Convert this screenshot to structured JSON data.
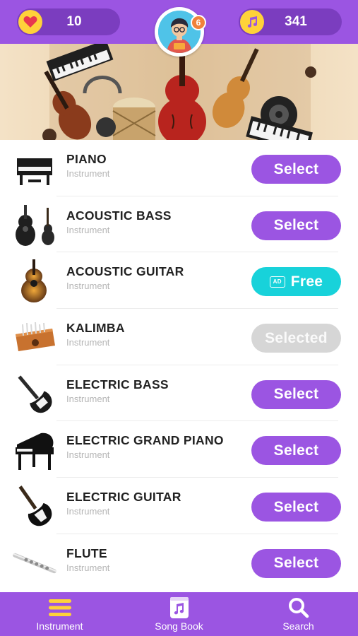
{
  "header": {
    "lives": "10",
    "notes": "341",
    "avatar_badge": "6"
  },
  "instruments": [
    {
      "name": "PIANO",
      "subtitle": "Instrument",
      "button": "Select",
      "state": "select"
    },
    {
      "name": "ACOUSTIC BASS",
      "subtitle": "Instrument",
      "button": "Select",
      "state": "select"
    },
    {
      "name": "ACOUSTIC GUITAR",
      "subtitle": "Instrument",
      "button": "Free",
      "state": "free",
      "ad_label": "AD"
    },
    {
      "name": "KALIMBA",
      "subtitle": "Instrument",
      "button": "Selected",
      "state": "selected"
    },
    {
      "name": "ELECTRIC BASS",
      "subtitle": "Instrument",
      "button": "Select",
      "state": "select"
    },
    {
      "name": "ELECTRIC GRAND PIANO",
      "subtitle": "Instrument",
      "button": "Select",
      "state": "select"
    },
    {
      "name": "ELECTRIC GUITAR",
      "subtitle": "Instrument",
      "button": "Select",
      "state": "select"
    },
    {
      "name": "FLUTE",
      "subtitle": "Instrument",
      "button": "Select",
      "state": "select"
    }
  ],
  "nav": {
    "instrument": "Instrument",
    "song_book": "Song Book",
    "search": "Search"
  },
  "colors": {
    "primary": "#9b55e2",
    "header_pill": "#7b3dbf",
    "free": "#18d2da",
    "selected": "#d6d6d6",
    "accent_yellow": "#ffd23a",
    "badge": "#f0813b"
  }
}
